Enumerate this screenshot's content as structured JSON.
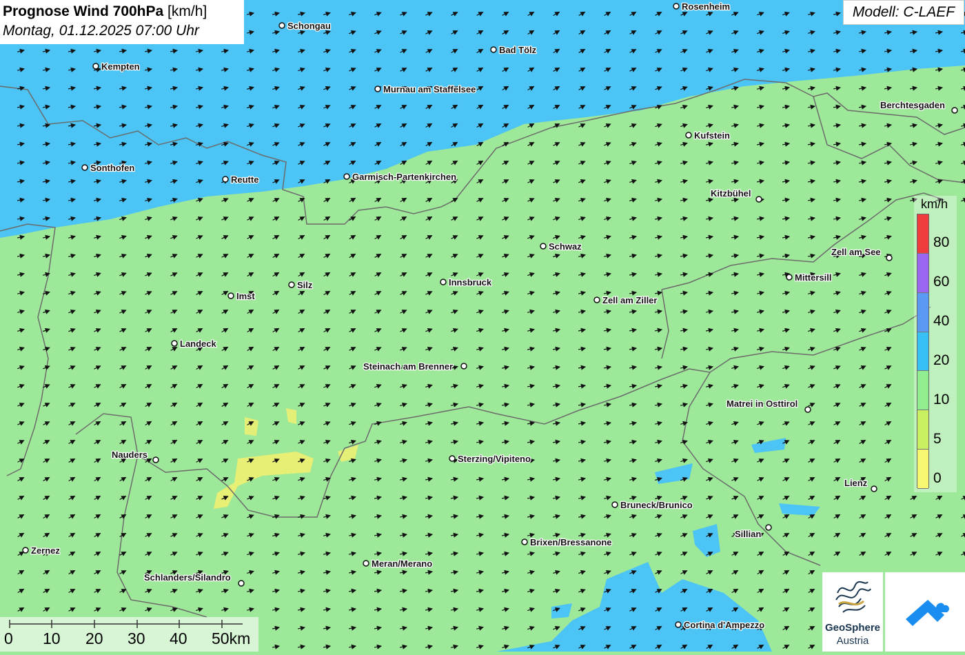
{
  "header": {
    "title_bold": "Prognose Wind 700hPa",
    "title_unit": "[km/h]",
    "datetime": "Montag, 01.12.2025 07:00 Uhr",
    "model": "Modell: C-LAEF"
  },
  "legend": {
    "unit": "km/h",
    "labels": [
      "80",
      "60",
      "40",
      "20",
      "10",
      "5",
      "0"
    ],
    "colors": [
      "#f03c3c",
      "#9a66f0",
      "#5a9af5",
      "#36c0f5",
      "#90ee90",
      "#c8f060",
      "#f8f870"
    ]
  },
  "scalebar": {
    "labels": [
      "0",
      "10",
      "20",
      "30",
      "40",
      "50km"
    ]
  },
  "cities": [
    {
      "name": "Rosenheim",
      "side": "right"
    },
    {
      "name": "Schongau",
      "side": "right"
    },
    {
      "name": "Bad Tölz",
      "side": "right"
    },
    {
      "name": "Kempten",
      "side": "right"
    },
    {
      "name": "Murnau am Staffelsee",
      "side": "right"
    },
    {
      "name": "Berchtesgaden",
      "side": "left"
    },
    {
      "name": "Kufstein",
      "side": "right"
    },
    {
      "name": "Sonthofen",
      "side": "right"
    },
    {
      "name": "Reutte",
      "side": "right"
    },
    {
      "name": "Garmisch-Partenkirchen",
      "side": "right"
    },
    {
      "name": "Kitzbühel",
      "side": "left"
    },
    {
      "name": "Schwaz",
      "side": "right"
    },
    {
      "name": "Zell am See",
      "side": "left"
    },
    {
      "name": "Mittersill",
      "side": "right"
    },
    {
      "name": "Silz",
      "side": "right"
    },
    {
      "name": "Innsbruck",
      "side": "right"
    },
    {
      "name": "Imst",
      "side": "right"
    },
    {
      "name": "Zell am Ziller",
      "side": "right"
    },
    {
      "name": "Landeck",
      "side": "right"
    },
    {
      "name": "Steinach am Brenner",
      "side": "left"
    },
    {
      "name": "Matrei in Osttirol",
      "side": "left"
    },
    {
      "name": "Nauders",
      "side": "left"
    },
    {
      "name": "Sterzing/Vipiteno",
      "side": "right"
    },
    {
      "name": "Lienz",
      "side": "left"
    },
    {
      "name": "Bruneck/Brunico",
      "side": "right"
    },
    {
      "name": "Sillian",
      "side": "left"
    },
    {
      "name": "Brixen/Bressanone",
      "side": "right"
    },
    {
      "name": "Zernez",
      "side": "right"
    },
    {
      "name": "Meran/Merano",
      "side": "right"
    },
    {
      "name": "Schlanders/Silandro",
      "side": "left"
    },
    {
      "name": "Cortina d'Ampezzo",
      "side": "right"
    }
  ],
  "logos": {
    "geosphere_line1": "GeoSphere",
    "geosphere_line2": "Austria"
  },
  "map_colors": {
    "land_wind": "#9ee89a",
    "north_wind": "#4cc4f5",
    "low_wind": "#f0f070",
    "border": "#6b6b6b",
    "arrow": "#111111"
  }
}
